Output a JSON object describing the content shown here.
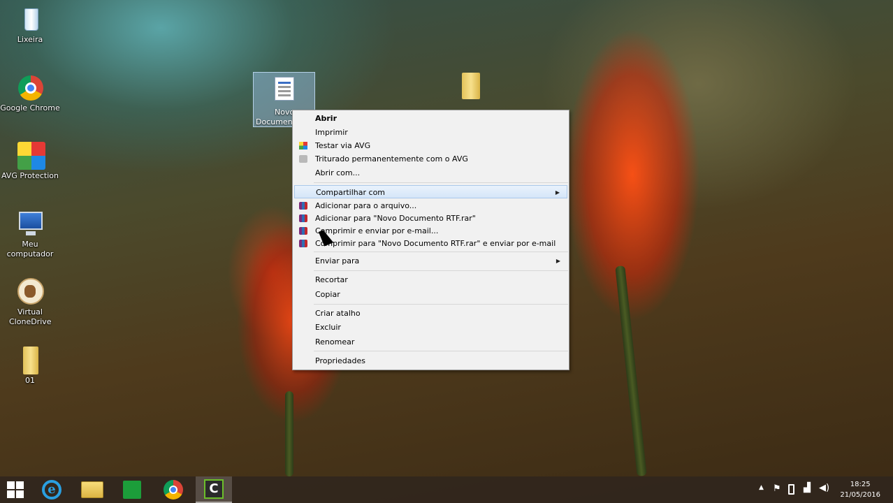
{
  "desktop": {
    "icons": [
      {
        "label": "Lixeira",
        "icon": "recycle-bin-icon"
      },
      {
        "label": "Google Chrome",
        "icon": "chrome-icon"
      },
      {
        "label": "AVG Protection",
        "icon": "avg-icon"
      },
      {
        "label": "Meu computador",
        "icon": "computer-icon"
      },
      {
        "label": "Virtual CloneDrive",
        "icon": "clonedrive-sheep-icon"
      },
      {
        "label": "01",
        "icon": "folder-icon"
      }
    ],
    "selected_file": {
      "label_line1": "Novo",
      "label_line2": "Document",
      "icon": "rtf-document-icon"
    },
    "top_folder": {
      "icon": "folder-icon"
    }
  },
  "context_menu": {
    "items": [
      {
        "label": "Abrir",
        "bold": true
      },
      {
        "label": "Imprimir"
      },
      {
        "label": "Testar via  AVG",
        "icon": "avg-icon"
      },
      {
        "label": "Triturado permanentemente com o AVG",
        "icon": "shredder-icon"
      },
      {
        "label": "Abrir com..."
      },
      {
        "label": "Compartilhar com",
        "submenu": true,
        "highlighted": true
      },
      {
        "label": "Adicionar para o arquivo...",
        "icon": "winrar-icon"
      },
      {
        "label": "Adicionar para \"Novo Documento RTF.rar\"",
        "icon": "winrar-icon"
      },
      {
        "label": "Comprimir e enviar por e-mail...",
        "icon": "winrar-icon"
      },
      {
        "label": "Comprimir para \"Novo Documento RTF.rar\" e enviar por e-mail",
        "icon": "winrar-icon"
      },
      {
        "label": "Enviar para",
        "submenu": true
      },
      {
        "label": "Recortar"
      },
      {
        "label": "Copiar"
      },
      {
        "label": "Criar atalho"
      },
      {
        "label": "Excluir"
      },
      {
        "label": "Renomear"
      },
      {
        "label": "Propriedades"
      }
    ]
  },
  "taskbar": {
    "buttons": [
      {
        "icon": "windows-start-icon"
      },
      {
        "icon": "internet-explorer-icon"
      },
      {
        "icon": "file-explorer-icon"
      },
      {
        "icon": "windows-store-icon"
      },
      {
        "icon": "chrome-icon"
      },
      {
        "icon": "camtasia-icon",
        "active": true
      }
    ],
    "tray": {
      "icons": [
        "show-hidden-icons-chevron",
        "action-center-flag-icon",
        "power-icon",
        "network-signal-icon",
        "volume-icon"
      ],
      "time": "18:25",
      "date": "21/05/2016"
    }
  },
  "colors": {
    "menu_highlight": "#d5e6f8",
    "taskbar": "#30261e"
  }
}
